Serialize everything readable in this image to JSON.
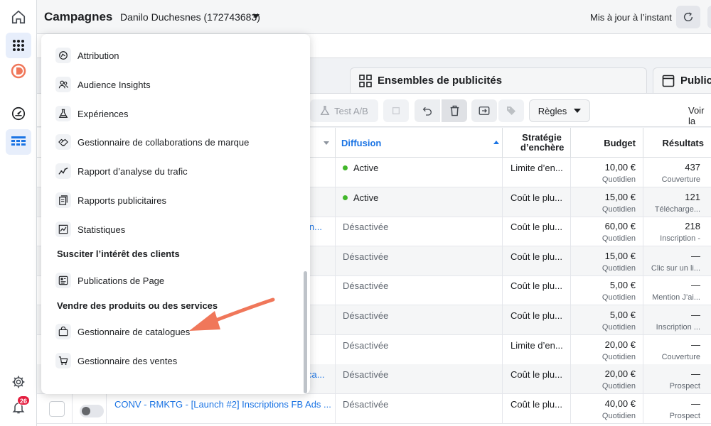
{
  "header": {
    "title": "Campagnes",
    "account": "Danilo Duchesnes (172743683)",
    "updated": "Mis à jour à l’instant"
  },
  "tabs": [
    {
      "label": "Ensembles de publicités",
      "icon": "grid-icon"
    },
    {
      "label": "Publici",
      "icon": "ad-icon"
    }
  ],
  "toolbar": {
    "test_ab": "Test A/B",
    "rules": "Règles",
    "voir": "Voir la"
  },
  "table": {
    "columns": {
      "diffusion": "Diffusion",
      "strategy": "Stratégie d’enchère",
      "budget": "Budget",
      "results": "Résultats"
    },
    "rows": [
      {
        "status": "Active",
        "active": true,
        "bid": "Limite d’en...",
        "budget": "10,00 €",
        "budget_sub": "Quotidien",
        "result": "437",
        "result_sub": "Couverture",
        "name": ""
      },
      {
        "status": "Active",
        "active": true,
        "bid": "Coût le plu...",
        "budget": "15,00 €",
        "budget_sub": "Quotidien",
        "result": "121",
        "result_sub": "Télécharge...",
        "name": ""
      },
      {
        "status": "Désactivée",
        "active": false,
        "bid": "Coût le plu...",
        "budget": "60,00 €",
        "budget_sub": "Quotidien",
        "result": "218",
        "result_sub": "Inscription -",
        "name": "in..."
      },
      {
        "status": "Désactivée",
        "active": false,
        "bid": "Coût le plu...",
        "budget": "15,00 €",
        "budget_sub": "Quotidien",
        "result": "—",
        "result_sub": "Clic sur un li...",
        "name": ""
      },
      {
        "status": "Désactivée",
        "active": false,
        "bid": "Coût le plu...",
        "budget": "5,00 €",
        "budget_sub": "Quotidien",
        "result": "—",
        "result_sub": "Mention J’ai...",
        "name": ""
      },
      {
        "status": "Désactivée",
        "active": false,
        "bid": "Coût le plu...",
        "budget": "5,00 €",
        "budget_sub": "Quotidien",
        "result": "—",
        "result_sub": "Inscription ...",
        "name": ""
      },
      {
        "status": "Désactivée",
        "active": false,
        "bid": "Limite d’en...",
        "budget": "20,00 €",
        "budget_sub": "Quotidien",
        "result": "—",
        "result_sub": "Couverture",
        "name": ""
      },
      {
        "status": "Désactivée",
        "active": false,
        "bid": "Coût le plu...",
        "budget": "20,00 €",
        "budget_sub": "Quotidien",
        "result": "—",
        "result_sub": "Prospect",
        "name": "ca..."
      },
      {
        "status": "Désactivée",
        "active": false,
        "bid": "Coût le plu...",
        "budget": "40,00 €",
        "budget_sub": "Quotidien",
        "result": "—",
        "result_sub": "Prospect",
        "name": "CONV - RMKTG - [Launch #2] Inscriptions FB Ads ..."
      }
    ]
  },
  "menu": {
    "items": [
      {
        "label": "Attribution",
        "icon": "attribution-icon"
      },
      {
        "label": "Audience Insights",
        "icon": "audience-icon"
      },
      {
        "label": "Expériences",
        "icon": "flask-icon"
      },
      {
        "label": "Gestionnaire de collaborations de marque",
        "icon": "handshake-icon"
      },
      {
        "label": "Rapport d’analyse du trafic",
        "icon": "traffic-icon"
      },
      {
        "label": "Rapports publicitaires",
        "icon": "reports-icon"
      },
      {
        "label": "Statistiques",
        "icon": "stats-icon"
      }
    ],
    "section_engage": "Susciter l’intérêt des clients",
    "engage_items": [
      {
        "label": "Publications de Page",
        "icon": "page-posts-icon"
      }
    ],
    "section_sell": "Vendre des produits ou des services",
    "sell_items": [
      {
        "label": "Gestionnaire de catalogues",
        "icon": "catalog-bag-icon"
      },
      {
        "label": "Gestionnaire des ventes",
        "icon": "cart-icon"
      }
    ]
  },
  "notifications": {
    "count": "26"
  },
  "colors": {
    "accent": "#1b74e4",
    "active": "#42b72a",
    "annotation_arrow": "#f0775a"
  }
}
